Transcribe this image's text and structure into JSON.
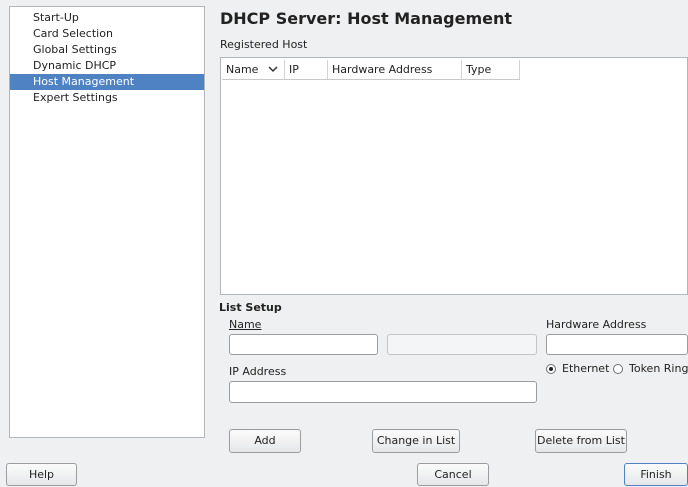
{
  "sidebar": {
    "items": [
      {
        "label": "Start-Up",
        "selected": false
      },
      {
        "label": "Card Selection",
        "selected": false
      },
      {
        "label": "Global Settings",
        "selected": false
      },
      {
        "label": "Dynamic DHCP",
        "selected": false
      },
      {
        "label": "Host Management",
        "selected": true
      },
      {
        "label": "Expert Settings",
        "selected": false
      }
    ]
  },
  "header": {
    "title": "DHCP Server: Host Management"
  },
  "hosts": {
    "label": "Registered Host",
    "columns": [
      "Name",
      "IP",
      "Hardware Address",
      "Type"
    ],
    "rows": []
  },
  "list_setup": {
    "title": "List Setup",
    "name_label": "Name",
    "name_value": "",
    "name_extra_value": "",
    "hardware_label": "Hardware Address",
    "hardware_value": "",
    "ip_label": "IP Address",
    "ip_value": "",
    "type_options": [
      {
        "label": "Ethernet",
        "checked": true
      },
      {
        "label": "Token Ring",
        "checked": false
      }
    ]
  },
  "actions": {
    "add": "Add",
    "change": "Change in List",
    "delete": "Delete from List"
  },
  "footer": {
    "help": "Help",
    "cancel": "Cancel",
    "finish": "Finish"
  },
  "colors": {
    "accent": "#4e82c3",
    "background": "#eff0f1"
  }
}
